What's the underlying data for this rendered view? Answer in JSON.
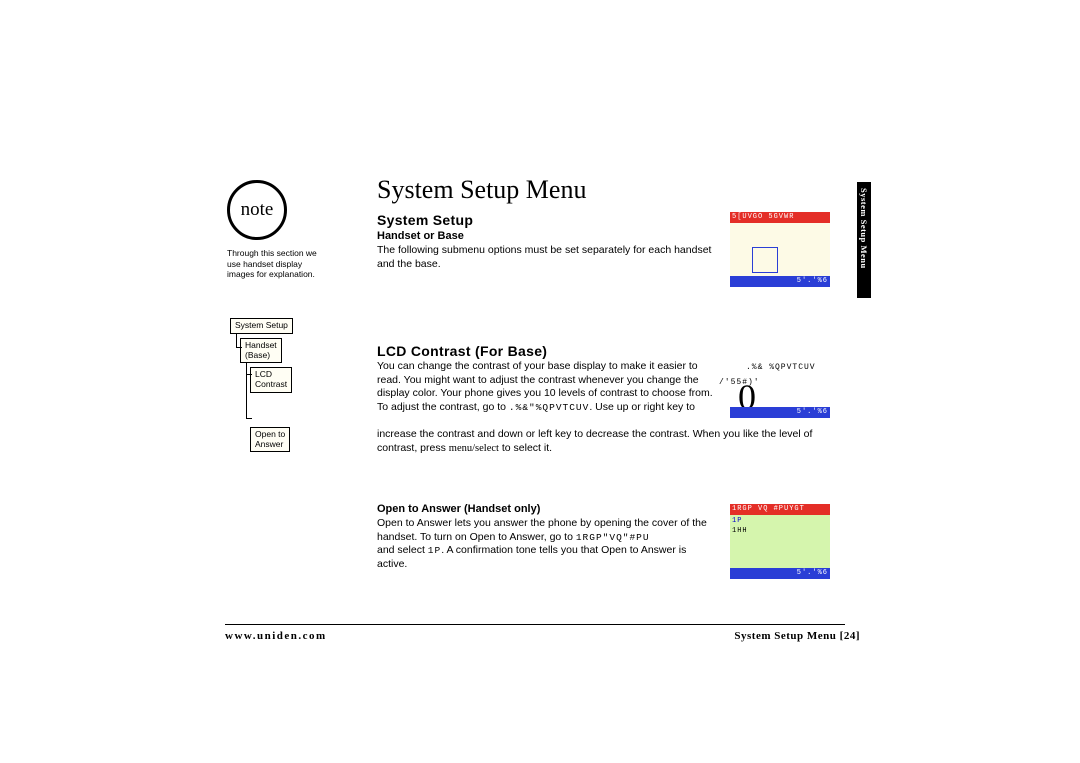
{
  "note": {
    "label": "note",
    "text": "Through this section we use handset display images for explanation."
  },
  "tree": {
    "n0": "System Setup",
    "n1a": "Handset",
    "n1b": "(Base)",
    "n2a": "LCD",
    "n2b": "Contrast",
    "n3a": "Open to",
    "n3b": "Answer"
  },
  "title": "System Setup Menu",
  "h1": "System Setup",
  "h2": "Handset or Base",
  "p1": "The following submenu options must be set separately for each handset and the base.",
  "h3": "LCD Contrast (For Base)",
  "p2a": "You can change the contrast of your base display to make it easier to read. You might want to adjust the contrast whenever you change the display color. Your phone gives you 10 levels of contrast to choose from. To adjust the contrast, go to ",
  "p2_code": ".%&\"%QPVTCUV",
  "p2b": ". Use up or right key to",
  "p2c": "increase the contrast and down or left key to decrease the contrast. When you like the level of contrast, press ",
  "p2_key": "menu/select",
  "p2d": " to select it.",
  "h4": "Open to Answer (Handset only)",
  "p3a": "Open to Answer lets you answer the phone by opening the cover of the handset. To turn on Open to Answer, go to ",
  "p3_code": "1RGP\"VQ\"#PU",
  "p3b": "and select ",
  "p3_code2": "1P",
  "p3c": ". A confirmation tone tells you that Open to Answer is active.",
  "screen1": {
    "header": "5[UVGO 5GVWR",
    "footer": "5'.'%6"
  },
  "screen2": {
    "label_top": ".%& %QPVTCUV",
    "label_left": "/'55#)'",
    "digit": "0",
    "footer": "5'.'%6"
  },
  "screen3": {
    "header": "1RGP VQ #PUYGT",
    "line1": "1P",
    "line2": "1HH",
    "footer": "5'.'%6"
  },
  "side_tab": "System Setup Menu",
  "footer": {
    "left": "www.uniden.com",
    "right": "System Setup Menu [24]"
  }
}
